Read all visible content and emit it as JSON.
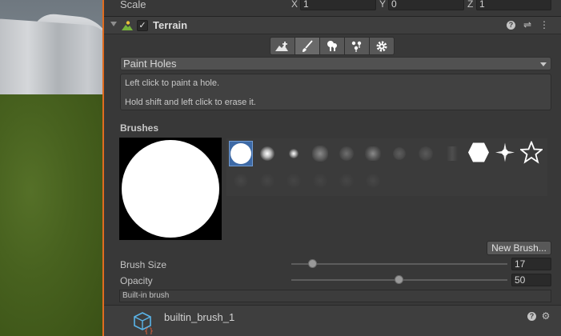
{
  "transform": {
    "scale_label": "Scale",
    "x_axis": "X",
    "x_value": "1",
    "y_axis": "Y",
    "y_value": "0",
    "z_axis": "Z",
    "z_value": "1"
  },
  "component": {
    "title": "Terrain",
    "enabled_mark": "✓",
    "help_glyph": "?",
    "presets_glyph": "⇌",
    "menu_glyph": "⋮"
  },
  "toolbar": {
    "tools": [
      "create-neighbor-terrains",
      "paint-terrain",
      "paint-trees",
      "paint-details",
      "terrain-settings"
    ],
    "active_tool": "paint-terrain"
  },
  "paint_mode": {
    "selected": "Paint Holes"
  },
  "help": {
    "line1": "Left click to paint a hole.",
    "line2": "Hold shift and left click to erase it."
  },
  "brushes": {
    "label": "Brushes",
    "selected_index": 0,
    "new_brush_label": "New Brush..."
  },
  "settings": {
    "brush_size_label": "Brush Size",
    "brush_size_value": "17",
    "brush_size_fraction": 0.1,
    "opacity_label": "Opacity",
    "opacity_value": "50",
    "opacity_fraction": 0.5
  },
  "brush_info": {
    "builtin_label": "Built-in brush"
  },
  "asset": {
    "name": "builtin_brush_1",
    "help_glyph": "?",
    "settings_glyph": "⚙"
  },
  "colors": {
    "scene_border": "#e06c1f",
    "selection": "#3e6aa6"
  }
}
